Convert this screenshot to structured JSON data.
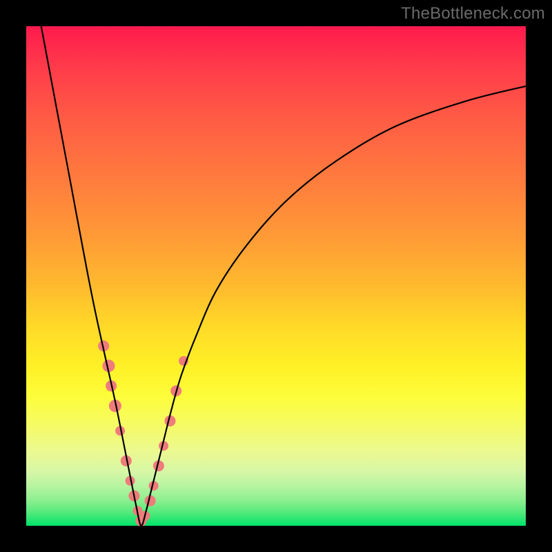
{
  "watermark": "TheBottleneck.com",
  "colors": {
    "frame": "#000000",
    "curve": "#000000",
    "marker": "#ef7b7b",
    "gradient_top": "#ff1a4d",
    "gradient_bottom": "#00e36a"
  },
  "chart_data": {
    "type": "line",
    "title": "",
    "xlabel": "",
    "ylabel": "",
    "xlim": [
      0,
      100
    ],
    "ylim": [
      0,
      100
    ],
    "note": "V-shaped bottleneck curve; y≈0 at optimum around x≈23; rises steeply both sides. Values read from position of curve within plot area (x and y as percent of axis span, y=0 bottom, y=100 top).",
    "series": [
      {
        "name": "bottleneck-curve",
        "x": [
          3,
          6,
          9,
          12,
          14,
          16,
          18,
          20,
          21,
          22,
          23,
          24,
          25,
          27,
          29,
          31,
          34,
          38,
          44,
          52,
          62,
          74,
          88,
          100
        ],
        "y": [
          100,
          84,
          68,
          52,
          42,
          33,
          24,
          14,
          9,
          4,
          0,
          3,
          7,
          15,
          23,
          30,
          38,
          47,
          56,
          65,
          73,
          80,
          85,
          88
        ]
      }
    ],
    "markers": {
      "name": "highlighted-points",
      "note": "Salmon dot clusters along lower arms of V-curve.",
      "x": [
        15.5,
        16.5,
        17.0,
        17.8,
        18.8,
        20.0,
        20.8,
        21.6,
        22.3,
        23.0,
        23.8,
        24.8,
        25.5,
        26.5,
        27.5,
        28.8,
        30.0,
        31.5
      ],
      "y": [
        36,
        32,
        28,
        24,
        19,
        13,
        9,
        6,
        3,
        1,
        2,
        5,
        8,
        12,
        16,
        21,
        27,
        33
      ],
      "r": [
        8,
        9,
        8,
        9,
        7,
        8,
        7,
        8,
        7,
        8,
        7,
        8,
        7,
        8,
        7,
        8,
        8,
        7
      ]
    }
  }
}
